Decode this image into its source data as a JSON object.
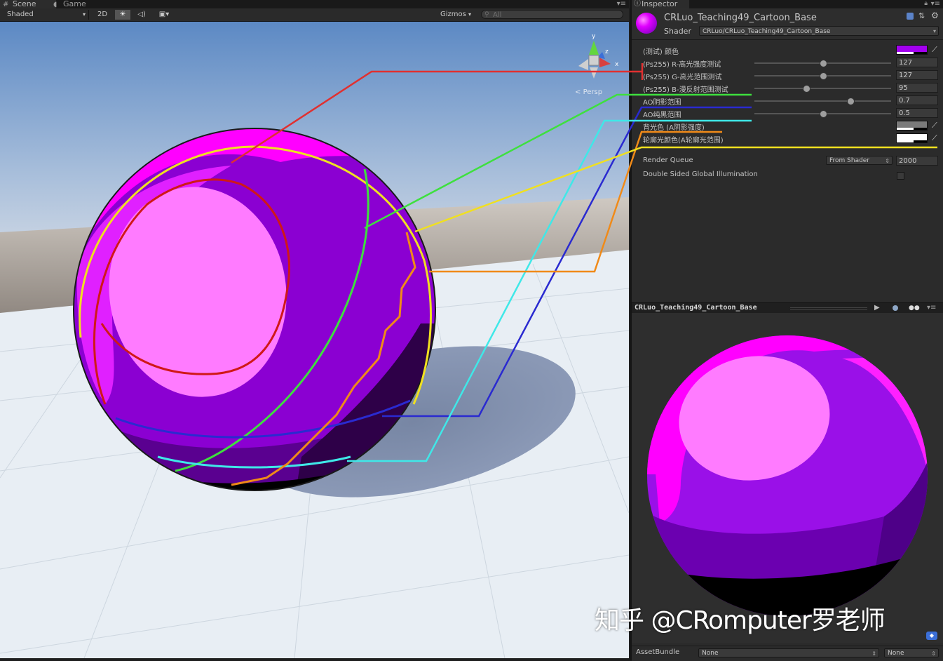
{
  "scene_tabs": [
    {
      "label": "Scene",
      "icon": "scene-grid-icon"
    },
    {
      "label": "Game",
      "icon": "game-pacman-icon"
    }
  ],
  "scene_toolbar": {
    "draw_mode": "Shaded",
    "mode_2d": "2D",
    "gizmos": "Gizmos",
    "search_placeholder": "All"
  },
  "viewport": {
    "gizmo_axes": [
      "y",
      "z",
      "x"
    ],
    "projection_label": "Persp"
  },
  "inspector": {
    "tab_label": "Inspector",
    "material_name": "CRLuo_Teaching49_Cartoon_Base",
    "shader_label": "Shader",
    "shader_value": "CRLuo/CRLuo_Teaching49_Cartoon_Base",
    "properties": [
      {
        "label": "(测试) 颜色",
        "type": "color",
        "color": "#a400f0"
      },
      {
        "label": "(Ps255) R-高光强度测试",
        "type": "slider",
        "value": "127",
        "fraction": 0.5
      },
      {
        "label": "(Ps255) G-高光范围测试",
        "type": "slider",
        "value": "127",
        "fraction": 0.5
      },
      {
        "label": "(Ps255) B-漫反射范围测试",
        "type": "slider",
        "value": "95",
        "fraction": 0.38
      },
      {
        "label": "AO阴影范围",
        "type": "slider",
        "value": "0.7",
        "fraction": 0.7
      },
      {
        "label": "AO纯黑范围",
        "type": "slider",
        "value": "0.5",
        "fraction": 0.5
      },
      {
        "label": "背光色 (A阴影强度)",
        "type": "color",
        "color": "#7a7a7a"
      },
      {
        "label": "轮廓光颜色(A轮廓光范围)",
        "type": "color",
        "color": "#ffffff"
      }
    ],
    "render_queue_label": "Render Queue",
    "render_queue_mode": "From Shader",
    "render_queue_value": "2000",
    "dsgi_label": "Double Sided Global Illumination",
    "preview_title": "CRLuo_Teaching49_Cartoon_Base",
    "assetbundle_label": "AssetBundle",
    "assetbundle_name": "None",
    "assetbundle_variant": "None"
  },
  "watermark": "知乎 @CRomputer罗老师",
  "colors": {
    "material_purple": "#a400f0",
    "ann_red": "#e03030",
    "ann_green": "#3ee03e",
    "ann_cyan": "#3fe8e8",
    "ann_blue": "#2a2ad0",
    "ann_orange": "#f08a18",
    "ann_yellow": "#f0e020"
  }
}
